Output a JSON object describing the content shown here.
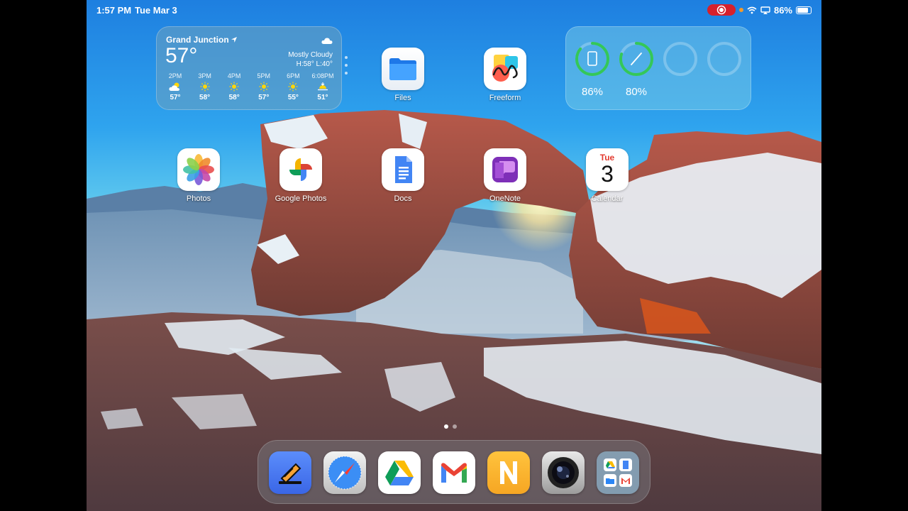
{
  "status_bar": {
    "time": "1:57 PM",
    "date": "Tue Mar 3",
    "battery": "86%",
    "battery_level": 0.86
  },
  "weather": {
    "city": "Grand Junction",
    "temperature": "57°",
    "condition": "Mostly Cloudy",
    "high_low": "H:58° L:40°",
    "hours": [
      {
        "time": "2PM",
        "icon": "partly-cloudy-icon",
        "temp": "57°"
      },
      {
        "time": "3PM",
        "icon": "sun-icon",
        "temp": "58°"
      },
      {
        "time": "4PM",
        "icon": "sun-icon",
        "temp": "58°"
      },
      {
        "time": "5PM",
        "icon": "sun-icon",
        "temp": "57°"
      },
      {
        "time": "6PM",
        "icon": "sun-icon",
        "temp": "55°"
      },
      {
        "time": "6:08PM",
        "icon": "sunset-icon",
        "temp": "51°"
      }
    ]
  },
  "batteries": [
    {
      "device": "ipad-icon",
      "percent": "86%",
      "level": 0.86
    },
    {
      "device": "pencil-icon",
      "percent": "80%",
      "level": 0.8
    }
  ],
  "apps": {
    "files": "Files",
    "freeform": "Freeform",
    "photos": "Photos",
    "google_photos": "Google Photos",
    "docs": "Docs",
    "onenote": "OneNote",
    "calendar": "Calendar",
    "calendar_day": "Tue",
    "calendar_date": "3"
  },
  "colors": {
    "ring_green": "#34c759",
    "record_red": "#d6202c"
  }
}
